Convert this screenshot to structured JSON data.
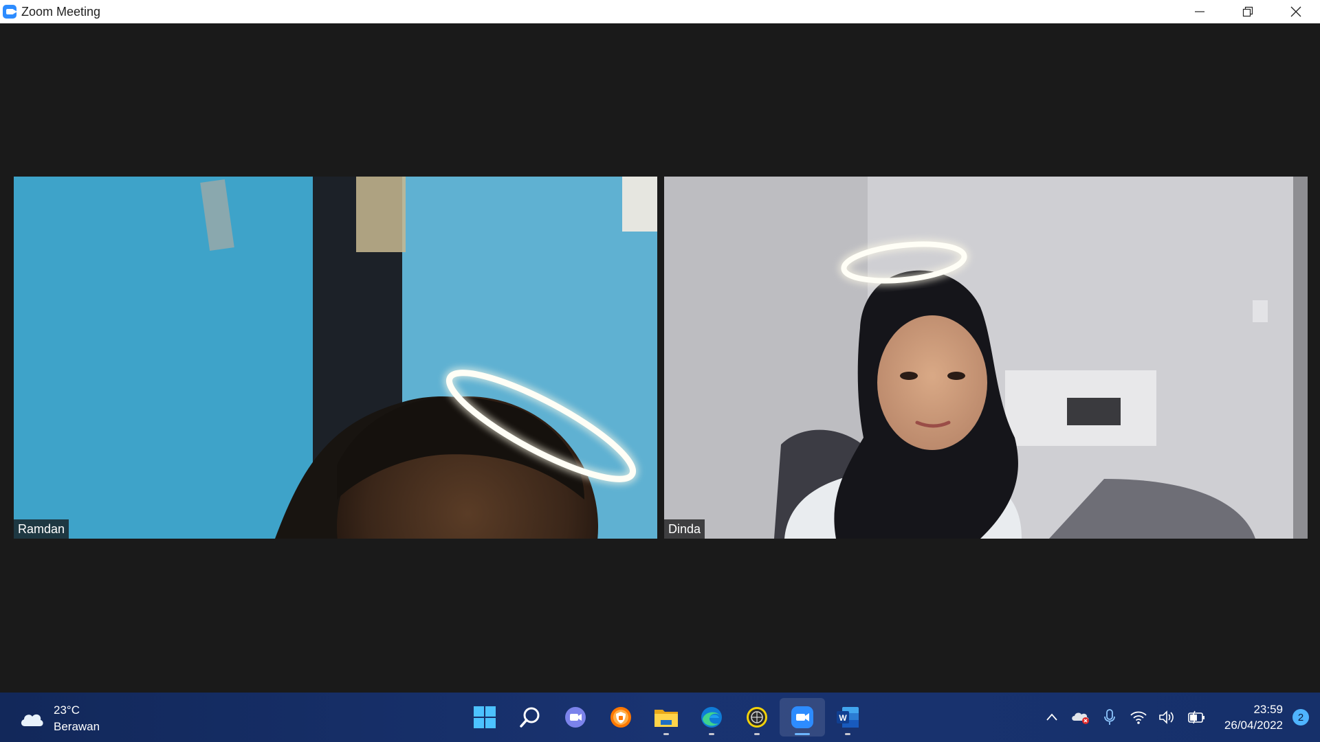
{
  "window": {
    "title": "Zoom Meeting"
  },
  "participants": [
    {
      "name": "Ramdan"
    },
    {
      "name": "Dinda"
    }
  ],
  "taskbar": {
    "weather": {
      "temperature": "23°C",
      "condition": "Berawan",
      "icon": "cloud-icon"
    },
    "apps": [
      {
        "name": "start",
        "icon": "windows-start-icon"
      },
      {
        "name": "search",
        "icon": "search-icon"
      },
      {
        "name": "chat",
        "icon": "teams-chat-icon"
      },
      {
        "name": "avast",
        "icon": "avast-browser-icon"
      },
      {
        "name": "file-explorer",
        "icon": "folder-icon"
      },
      {
        "name": "edge",
        "icon": "edge-icon"
      },
      {
        "name": "app-yellow",
        "icon": "globe-app-icon"
      },
      {
        "name": "zoom",
        "icon": "zoom-icon",
        "active": true
      },
      {
        "name": "word",
        "icon": "word-icon"
      }
    ],
    "clock": {
      "time": "23:59",
      "date": "26/04/2022"
    },
    "notifications": {
      "count": "2"
    }
  },
  "colors": {
    "zoom_blue": "#2d8cff",
    "taskbar": "#193371",
    "meeting_bg": "#1a1a1a"
  }
}
